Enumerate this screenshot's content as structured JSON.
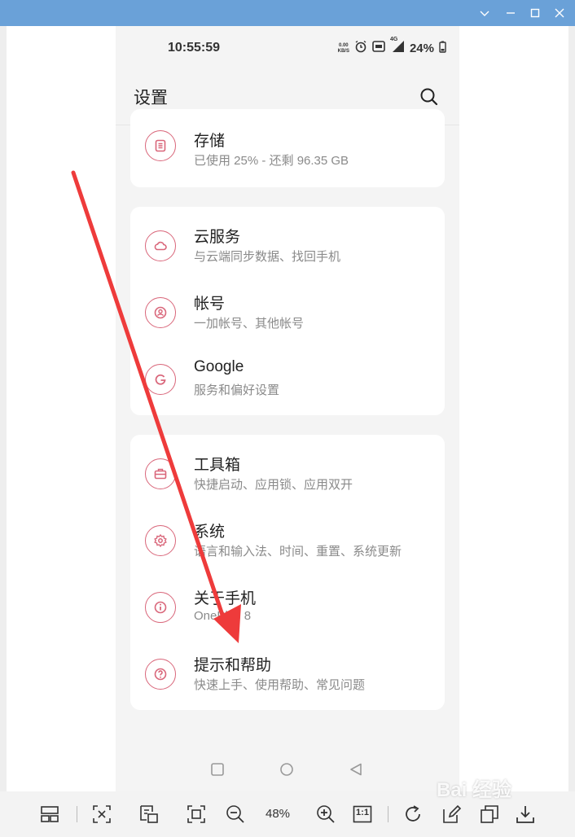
{
  "phone": {
    "status": {
      "time": "10:55:59",
      "net_top": "0.00",
      "net_bottom": "KB/S",
      "signal_label": "4G",
      "battery": "24%"
    },
    "header": {
      "title": "设置"
    },
    "storage": {
      "title": "存储",
      "sub": "已使用 25% - 还剩 96.35 GB"
    },
    "group1": [
      {
        "title": "云服务",
        "sub": "与云端同步数据、找回手机",
        "icon": "cloud-icon"
      },
      {
        "title": "帐号",
        "sub": "一加帐号、其他帐号",
        "icon": "account-icon"
      },
      {
        "title": "Google",
        "sub": "服务和偏好设置",
        "icon": "google-icon"
      }
    ],
    "group2": [
      {
        "title": "工具箱",
        "sub": "快捷启动、应用锁、应用双开",
        "icon": "toolbox-icon"
      },
      {
        "title": "系统",
        "sub": "语言和输入法、时间、重置、系统更新",
        "icon": "gear-icon"
      },
      {
        "title": "关于手机",
        "sub": "OnePlus 8",
        "icon": "info-icon"
      },
      {
        "title": "提示和帮助",
        "sub": "快速上手、使用帮助、常见问题",
        "icon": "help-icon"
      }
    ]
  },
  "toolbar": {
    "zoom": "48%",
    "actual_size": "1:1"
  },
  "watermark": "Bai 经验",
  "colors": {
    "accent": "#d9667a",
    "titlebar": "#6aa1d8",
    "arrow": "#ee3b3b"
  }
}
